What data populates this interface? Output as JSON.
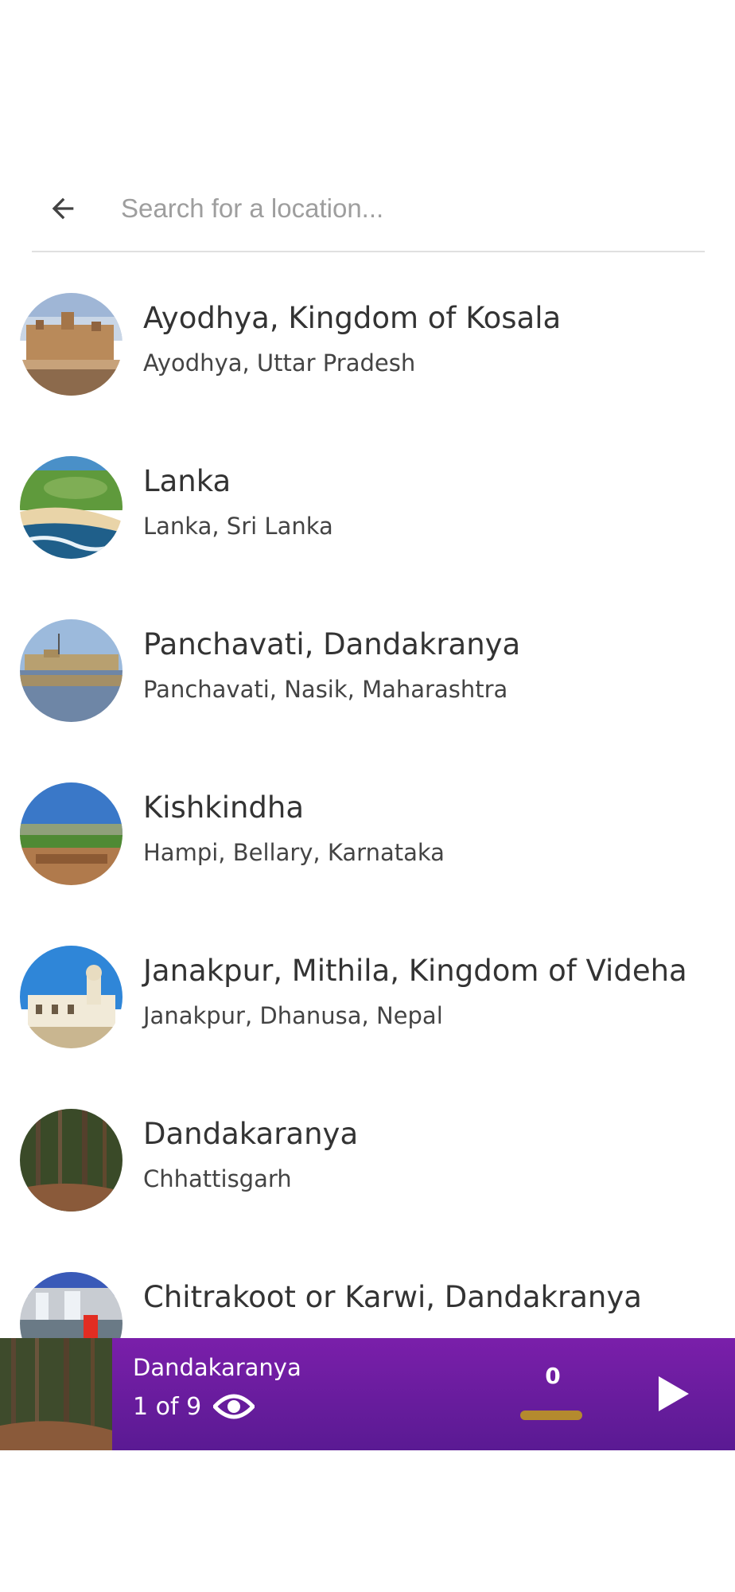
{
  "search": {
    "placeholder": "Search for a location..."
  },
  "icons": {
    "back": "arrow-left-icon",
    "eye": "eye-icon",
    "play": "play-icon"
  },
  "locations": [
    {
      "title": "Ayodhya, Kingdom of Kosala",
      "subtitle": "Ayodhya, Uttar Pradesh"
    },
    {
      "title": "Lanka",
      "subtitle": "Lanka, Sri Lanka"
    },
    {
      "title": "Panchavati, Dandakranya",
      "subtitle": "Panchavati, Nasik, Maharashtra"
    },
    {
      "title": "Kishkindha",
      "subtitle": "Hampi, Bellary, Karnataka"
    },
    {
      "title": "Janakpur, Mithila, Kingdom of Videha",
      "subtitle": "Janakpur, Dhanusa, Nepal"
    },
    {
      "title": "Dandakaranya",
      "subtitle": "Chhattisgarh"
    },
    {
      "title": "Chitrakoot or Karwi, Dandakranya",
      "subtitle": ""
    }
  ],
  "player": {
    "title": "Dandakaranya",
    "position": "1 of 9",
    "counter": "0"
  },
  "colors": {
    "player_bg": "#6a1b9a",
    "counter_bar": "#b48a2e",
    "divider": "#e0e0e0"
  }
}
